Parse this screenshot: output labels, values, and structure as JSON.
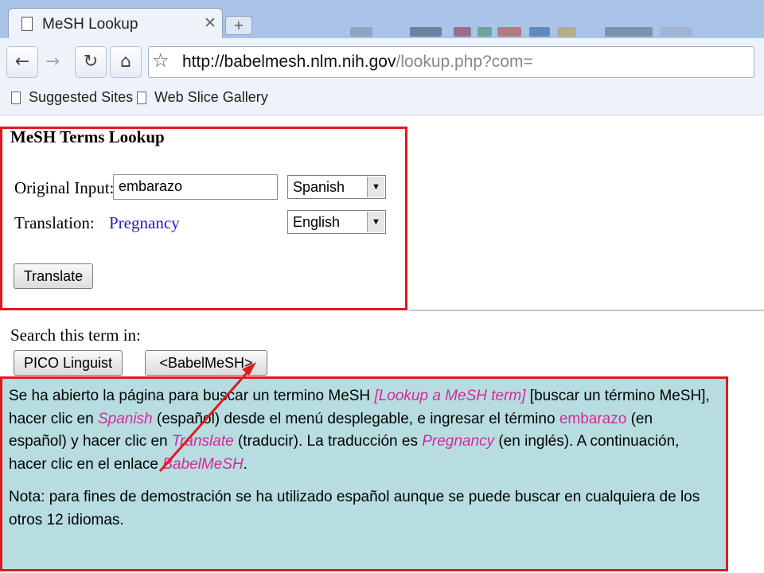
{
  "browser": {
    "tab_title": "MeSH Lookup",
    "tab_close": "✕",
    "new_tab": "+",
    "url_host": "http://babelmesh.nlm.nih.gov",
    "url_path": "/lookup.php?com=",
    "bookmarks": [
      "Suggested Sites",
      "Web Slice Gallery"
    ]
  },
  "form": {
    "title": "MeSH Terms Lookup",
    "original_label": "Original Input:",
    "original_value": "embarazo",
    "source_language": "Spanish",
    "translation_label": "Translation:",
    "translation_value": "Pregnancy",
    "target_language": "English",
    "translate_button": "Translate"
  },
  "search": {
    "label": "Search this term in:",
    "buttons": [
      "PICO Linguist",
      "<BabelMeSH>"
    ]
  },
  "annotation": {
    "p1_a": "Se ha abierto la página para buscar un termino MeSH ",
    "p1_b": "[Lookup a MeSH term]",
    "p1_c": " [buscar un término MeSH], hacer clic en ",
    "p1_d": "Spanish",
    "p1_e": " (español) desde el menú desplegable, e ingresar el término ",
    "p1_f": "embarazo",
    "p1_g": " (en español) y hacer clic en ",
    "p1_h": "Translate",
    "p1_i": " (traducir). La traducción es ",
    "p1_j": "Pregnancy",
    "p1_k": " (en inglés). A continuación, hacer clic en el enlace ",
    "p1_l": "BabelMeSH",
    "p1_m": ".",
    "p2": "Nota: para fines de demostración se ha utilizado español aunque se puede buscar en cualquiera de los otros 12 idiomas."
  },
  "colors": {
    "highlight_border": "#e01a1a",
    "callout_bg": "#b7dde0",
    "emphasis_text": "#d6289a",
    "translation_text": "#1c1cc8"
  }
}
